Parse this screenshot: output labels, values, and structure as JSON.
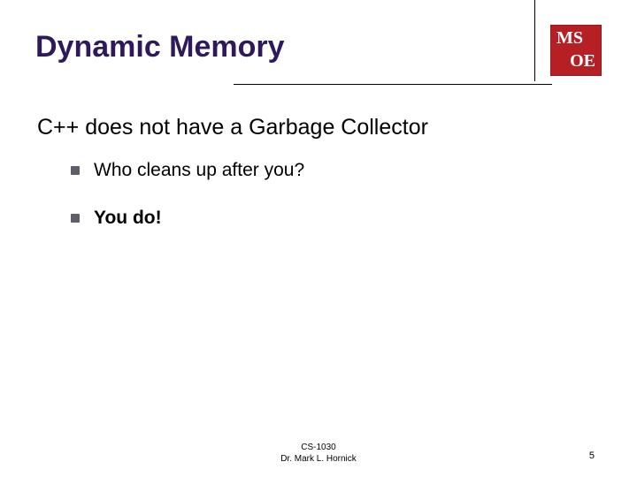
{
  "logo": {
    "top": "MS",
    "bottom": "OE"
  },
  "title": "Dynamic Memory",
  "subhead": "C++ does not have a Garbage Collector",
  "bullets": [
    {
      "text": "Who cleans up after you?",
      "bold": false
    },
    {
      "text": "You do!",
      "bold": true
    }
  ],
  "footer": {
    "line1": "CS-1030",
    "line2": "Dr. Mark L. Hornick"
  },
  "page": "5"
}
